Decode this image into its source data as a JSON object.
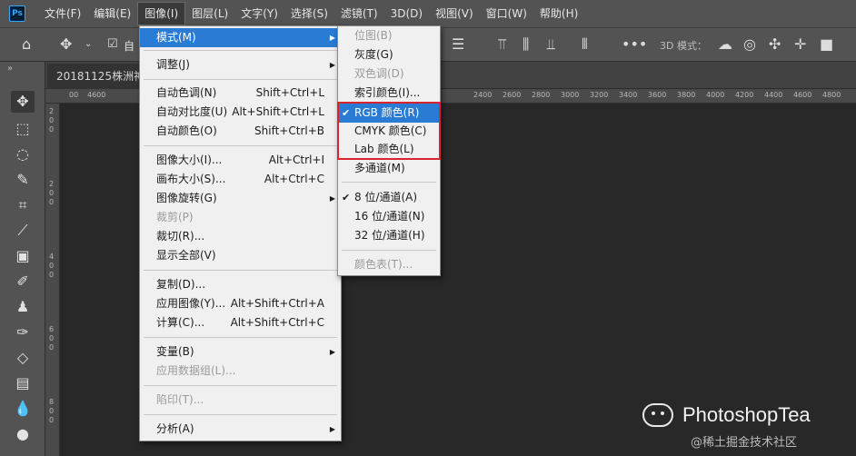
{
  "menubar": {
    "logo": "Ps",
    "items": [
      "文件(F)",
      "编辑(E)",
      "图像(I)",
      "图层(L)",
      "文字(Y)",
      "选择(S)",
      "滤镜(T)",
      "3D(D)",
      "视图(V)",
      "窗口(W)",
      "帮助(H)"
    ]
  },
  "options_bar": {
    "auto_label": "自",
    "mode_3d_label": "3D 模式："
  },
  "tab": {
    "document": "20181125株洲神"
  },
  "ruler": {
    "ticks": [
      "00",
      "4600",
      "2400",
      "2600",
      "2800",
      "3000",
      "3200",
      "3400",
      "3600",
      "3800",
      "4000",
      "4200",
      "4400",
      "4600",
      "4800"
    ],
    "left_ticks": [
      "2",
      "0",
      "0",
      "2",
      "0",
      "0",
      "4",
      "0",
      "0",
      "6",
      "0",
      "0",
      "8",
      "0",
      "0"
    ]
  },
  "image_menu": {
    "items": [
      {
        "label": "模式(M)",
        "shortcut": "",
        "submenu": true,
        "disabled": false,
        "highlight": true
      },
      {
        "label": "调整(J)",
        "shortcut": "",
        "submenu": true,
        "disabled": false
      },
      {
        "label": "自动色调(N)",
        "shortcut": "Shift+Ctrl+L",
        "disabled": false
      },
      {
        "label": "自动对比度(U)",
        "shortcut": "Alt+Shift+Ctrl+L",
        "disabled": false
      },
      {
        "label": "自动颜色(O)",
        "shortcut": "Shift+Ctrl+B",
        "disabled": false
      },
      {
        "label": "图像大小(I)...",
        "shortcut": "Alt+Ctrl+I",
        "disabled": false
      },
      {
        "label": "画布大小(S)...",
        "shortcut": "Alt+Ctrl+C",
        "disabled": false
      },
      {
        "label": "图像旋转(G)",
        "shortcut": "",
        "submenu": true,
        "disabled": false
      },
      {
        "label": "裁剪(P)",
        "shortcut": "",
        "disabled": true
      },
      {
        "label": "裁切(R)...",
        "shortcut": "",
        "disabled": false
      },
      {
        "label": "显示全部(V)",
        "shortcut": "",
        "disabled": false
      },
      {
        "label": "复制(D)...",
        "shortcut": "",
        "disabled": false
      },
      {
        "label": "应用图像(Y)...",
        "shortcut": "Alt+Shift+Ctrl+A",
        "disabled": false
      },
      {
        "label": "计算(C)...",
        "shortcut": "Alt+Shift+Ctrl+C",
        "disabled": false
      },
      {
        "label": "变量(B)",
        "shortcut": "",
        "submenu": true,
        "disabled": false
      },
      {
        "label": "应用数据组(L)...",
        "shortcut": "",
        "disabled": true
      },
      {
        "label": "陷印(T)...",
        "shortcut": "",
        "disabled": true
      },
      {
        "label": "分析(A)",
        "shortcut": "",
        "submenu": true,
        "disabled": false
      }
    ]
  },
  "mode_menu": {
    "items": [
      {
        "label": "位图(B)",
        "disabled": true,
        "checked": false
      },
      {
        "label": "灰度(G)",
        "disabled": false,
        "checked": false
      },
      {
        "label": "双色调(D)",
        "disabled": true,
        "checked": false
      },
      {
        "label": "索引颜色(I)...",
        "disabled": false,
        "checked": false
      },
      {
        "label": "RGB 颜色(R)",
        "disabled": false,
        "checked": true
      },
      {
        "label": "CMYK 颜色(C)",
        "disabled": false,
        "checked": false
      },
      {
        "label": "Lab 颜色(L)",
        "disabled": false,
        "checked": false
      },
      {
        "label": "多通道(M)",
        "disabled": false,
        "checked": false
      },
      {
        "label": "8 位/通道(A)",
        "disabled": false,
        "checked": true
      },
      {
        "label": "16 位/通道(N)",
        "disabled": false,
        "checked": false
      },
      {
        "label": "32 位/通道(H)",
        "disabled": false,
        "checked": false
      },
      {
        "label": "颜色表(T)...",
        "disabled": true,
        "checked": false
      }
    ],
    "check_glyph": "✔"
  },
  "watermark": {
    "title": "PhotoshopTea",
    "sub": "@稀土掘金技术社区"
  },
  "colors": {
    "highlight": "#2a7bd4",
    "annotation_box": "#d9232e"
  }
}
